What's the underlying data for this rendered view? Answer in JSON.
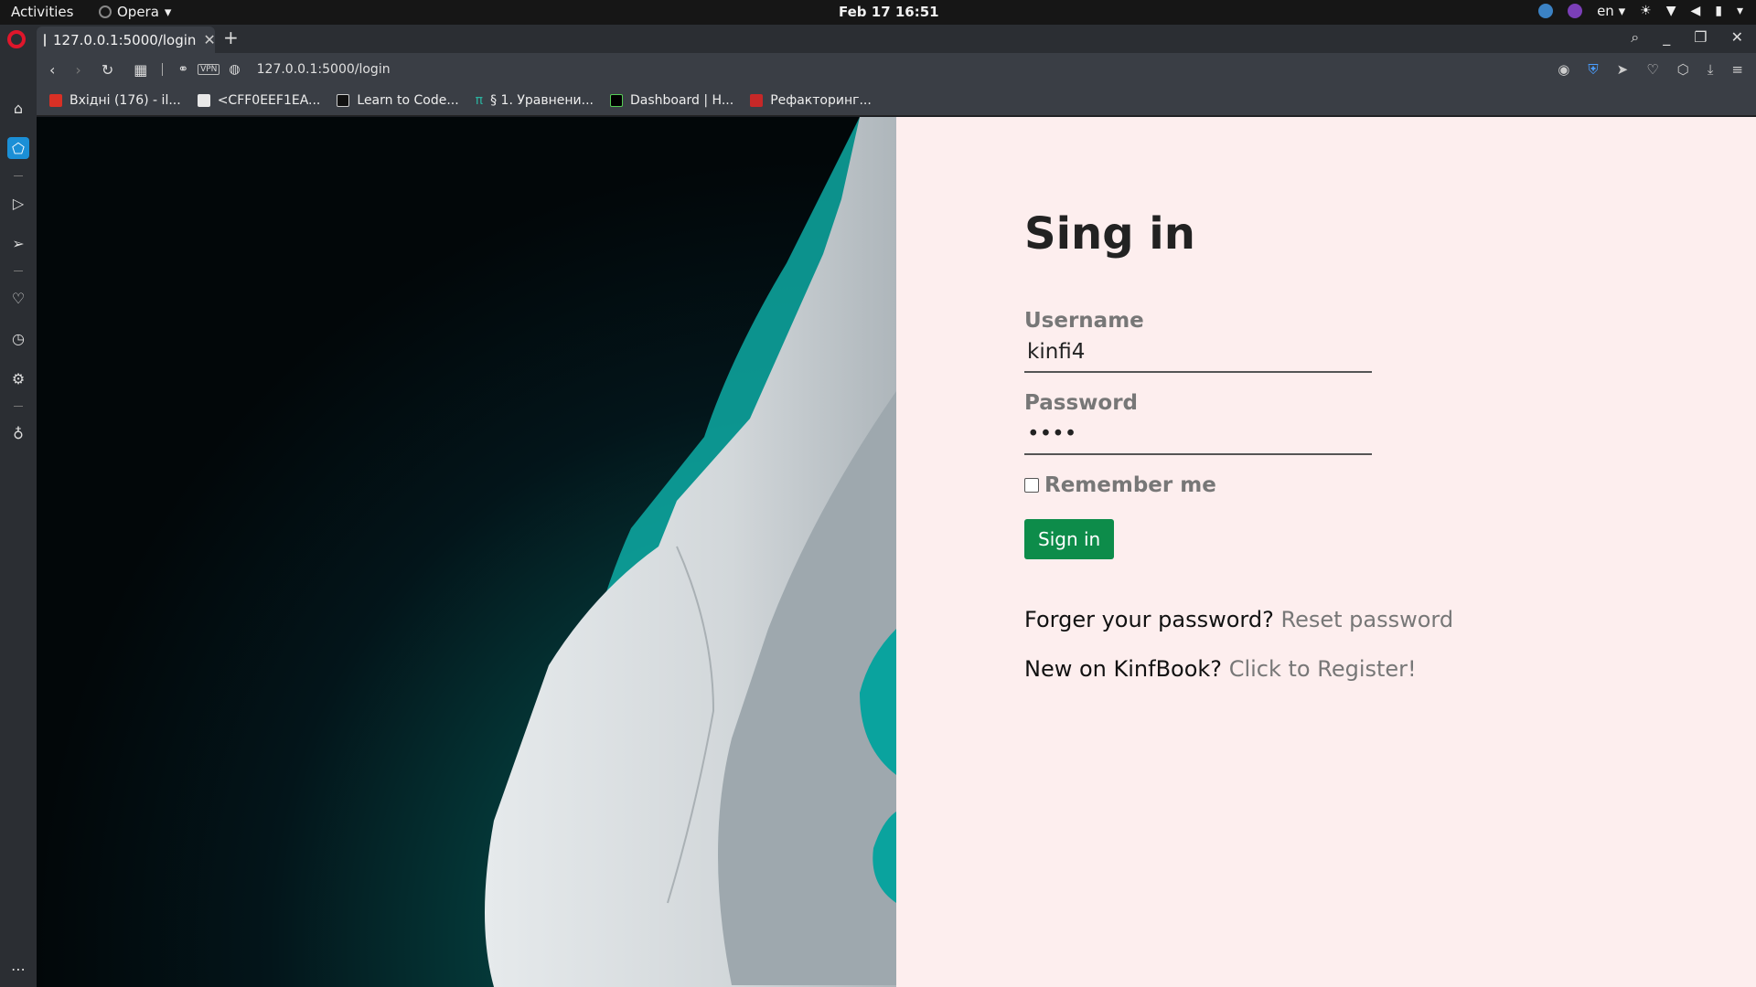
{
  "topbar": {
    "activities": "Activities",
    "app_name": "Opera",
    "clock": "Feb 17  16:51",
    "lang": "en"
  },
  "tab": {
    "title": "127.0.0.1:5000/login",
    "new_tab": "+"
  },
  "address": {
    "url": "127.0.0.1:5000/login",
    "vpn": "VPN"
  },
  "bookmarks": [
    {
      "label": "Вхідні (176) - il...",
      "color": "#d93025"
    },
    {
      "label": "<CFF0EEF1EA...",
      "color": "#e8e8e8"
    },
    {
      "label": "Learn to Code...",
      "color": "#111111"
    },
    {
      "label": "§ 1. Уравнени...",
      "color": "#2bb3a0"
    },
    {
      "label": "Dashboard | H...",
      "color": "#000000"
    },
    {
      "label": "Рефакторинг...",
      "color": "#c62828"
    }
  ],
  "login": {
    "heading": "Sing in",
    "username_label": "Username",
    "username_value": "kinfi4",
    "password_label": "Password",
    "password_value": "••••",
    "remember_label": "Remember me",
    "submit": "Sign in",
    "forgot_text": "Forger your password?",
    "forgot_link": "Reset password",
    "register_text": "New on KinfBook?",
    "register_link": "Click to Register!"
  },
  "colors": {
    "panel_bg": "#fdeeee",
    "button": "#0d8c4a",
    "sea": "#00a8a3"
  }
}
